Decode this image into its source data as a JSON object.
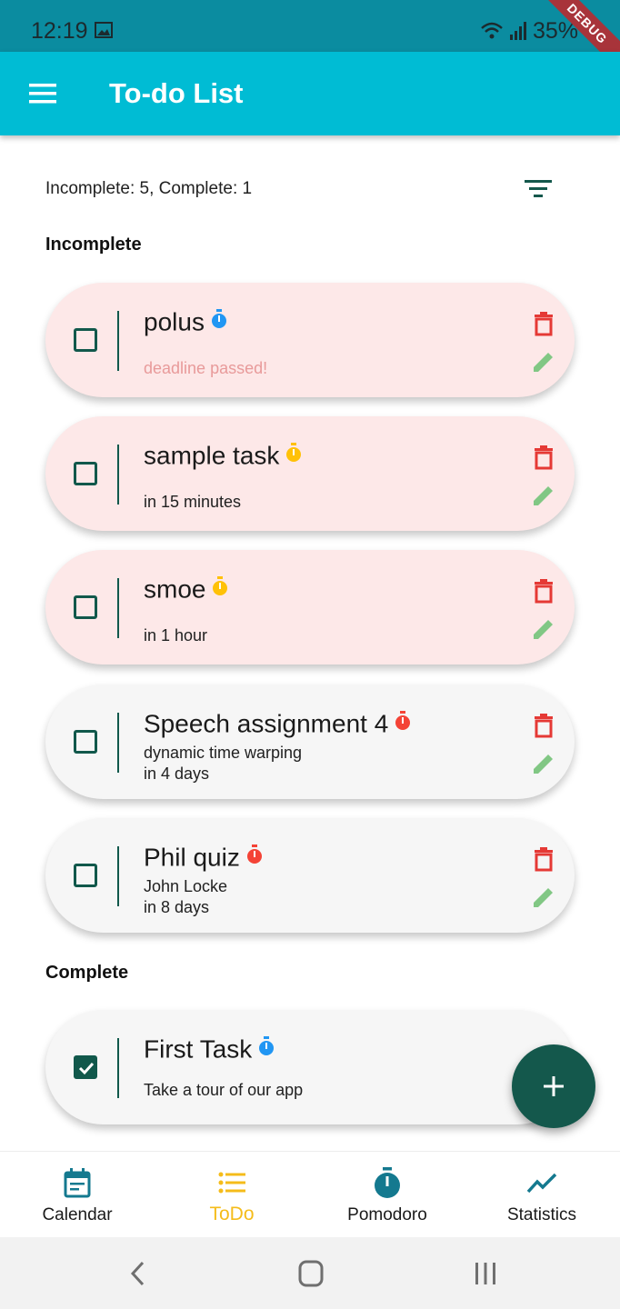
{
  "status_bar": {
    "time": "12:19",
    "battery": "35%",
    "debug": "DEBUG"
  },
  "app_bar": {
    "title": "To-do List"
  },
  "summary": "Incomplete: 5, Complete: 1",
  "sections": {
    "incomplete": "Incomplete",
    "complete": "Complete"
  },
  "tasks": [
    {
      "title": "polus",
      "desc": "deadline passed!",
      "priority_color": "#2196f3",
      "status": "overdue"
    },
    {
      "title": "sample task",
      "desc": "in 15 minutes",
      "priority_color": "#ffc107",
      "status": "overdue"
    },
    {
      "title": "smoe",
      "desc": "in 1 hour",
      "priority_color": "#ffc107",
      "status": "overdue"
    },
    {
      "title": "Speech assignment 4",
      "note": "dynamic time warping",
      "desc": "in 4 days",
      "priority_color": "#f44336",
      "status": "normal"
    },
    {
      "title": "Phil quiz",
      "note": "John Locke",
      "desc": "in 8 days",
      "priority_color": "#f44336",
      "status": "normal"
    }
  ],
  "completed_tasks": [
    {
      "title": "First Task",
      "desc": "Take a tour of our app",
      "priority_color": "#2196f3"
    }
  ],
  "bottom_nav": [
    {
      "label": "Calendar",
      "icon": "calendar-icon"
    },
    {
      "label": "ToDo",
      "icon": "list-icon",
      "active": true
    },
    {
      "label": "Pomodoro",
      "icon": "timer-icon"
    },
    {
      "label": "Statistics",
      "icon": "chart-icon"
    }
  ],
  "colors": {
    "app_bar": "#00bcd4",
    "status_bar": "#0b8ca0",
    "overdue_card": "#fde8e8",
    "normal_card": "#f6f6f6",
    "accent": "#14584c",
    "delete": "#e53935",
    "edit": "#81c784",
    "active_tab": "#f5bc1a"
  }
}
